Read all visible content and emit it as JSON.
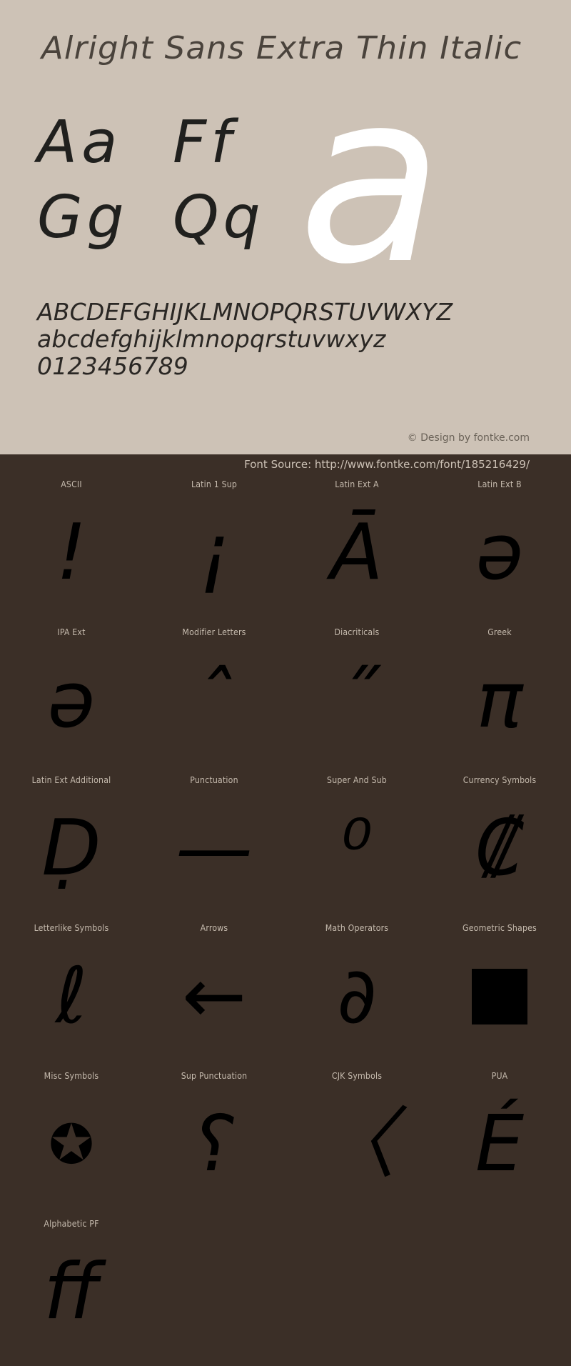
{
  "specimen": {
    "title": "Alright Sans Extra Thin Italic",
    "showcase_glyph": "a",
    "pairs": [
      [
        "Aa",
        "Ff"
      ],
      [
        "Gg",
        "Qq"
      ]
    ],
    "alphabet_upper": "ABCDEFGHIJKLMNOPQRSTUVWXYZ",
    "alphabet_lower": "abcdefghijklmnopqrstuvwxyz",
    "digits": "0123456789",
    "credit": "© Design by fontke.com",
    "source": "Font Source: http://www.fontke.com/font/185216429/",
    "colors": {
      "panel_background": "#cdc2b6",
      "dark_background": "#3b2f27",
      "showcase_glyph": "#ffffff",
      "title_text": "#4a433c",
      "label_text": "#c6bbae",
      "glyph_ink": "#000000"
    }
  },
  "unicode_blocks": {
    "rows": [
      [
        {
          "label": "ASCII",
          "glyph": "!",
          "size": "normal"
        },
        {
          "label": "Latin 1 Sup",
          "glyph": "¡",
          "size": "normal"
        },
        {
          "label": "Latin Ext A",
          "glyph": "Ā",
          "size": "normal"
        },
        {
          "label": "Latin Ext B",
          "glyph": "ə",
          "size": "normal"
        }
      ],
      [
        {
          "label": "IPA Ext",
          "glyph": "ə",
          "size": "normal"
        },
        {
          "label": "Modifier Letters",
          "glyph": "ˆ",
          "size": "normal"
        },
        {
          "label": "Diacriticals",
          "glyph": "˝",
          "size": "normal"
        },
        {
          "label": "Greek",
          "glyph": "π",
          "size": "normal"
        }
      ],
      [
        {
          "label": "Latin Ext Additional",
          "glyph": "Ḍ",
          "size": "normal"
        },
        {
          "label": "Punctuation",
          "glyph": "—",
          "size": "normal"
        },
        {
          "label": "Super And Sub",
          "glyph": "⁰",
          "size": "normal"
        },
        {
          "label": "Currency Symbols",
          "glyph": "₡",
          "size": "normal"
        }
      ],
      [
        {
          "label": "Letterlike Symbols",
          "glyph": "ℓ",
          "size": "normal"
        },
        {
          "label": "Arrows",
          "glyph": "←",
          "size": "normal"
        },
        {
          "label": "Math Operators",
          "glyph": "∂",
          "size": "normal"
        },
        {
          "label": "Geometric Shapes",
          "glyph": "",
          "size": "box"
        }
      ],
      [
        {
          "label": "Misc Symbols",
          "glyph": "✪",
          "size": "small"
        },
        {
          "label": "Sup Punctuation",
          "glyph": "⸮",
          "size": "normal"
        },
        {
          "label": "CJK Symbols",
          "glyph": "〈",
          "size": "normal"
        },
        {
          "label": "PUA",
          "glyph": "É",
          "size": "normal"
        }
      ],
      [
        {
          "label": "Alphabetic PF",
          "glyph": "ﬀ",
          "size": "normal"
        },
        {
          "label": "",
          "glyph": "",
          "size": "empty"
        },
        {
          "label": "",
          "glyph": "",
          "size": "empty"
        },
        {
          "label": "",
          "glyph": "",
          "size": "empty"
        }
      ]
    ]
  }
}
